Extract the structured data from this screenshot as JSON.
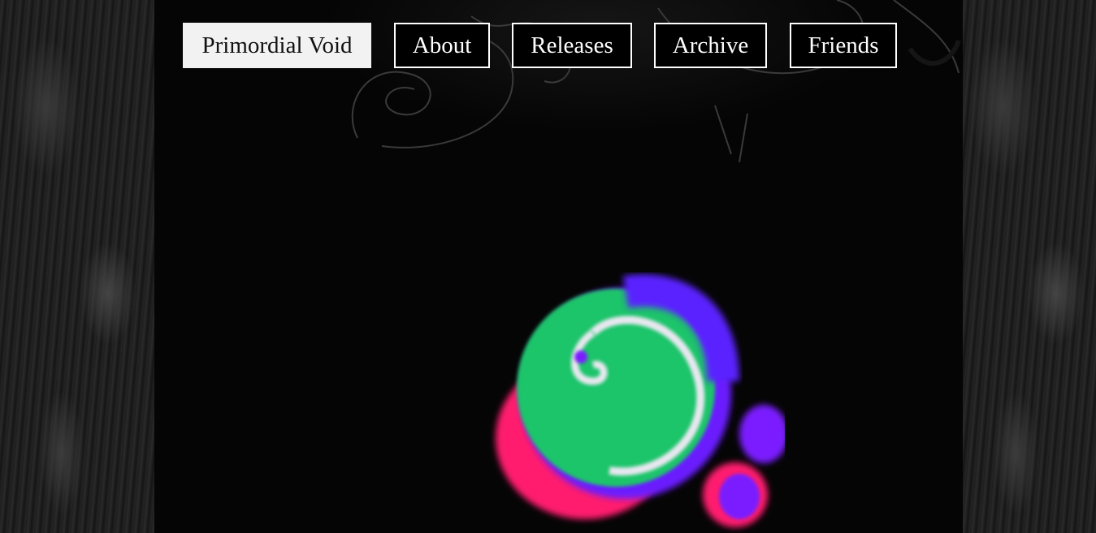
{
  "nav": {
    "items": [
      {
        "label": "Primordial Void",
        "active": true
      },
      {
        "label": "About",
        "active": false
      },
      {
        "label": "Releases",
        "active": false
      },
      {
        "label": "Archive",
        "active": false
      },
      {
        "label": "Friends",
        "active": false
      }
    ]
  },
  "colors": {
    "background": "#050505",
    "nav_border": "#ffffff",
    "nav_active_bg": "#f2f2f2",
    "orb_green": "#1fc46a",
    "orb_purple": "#7a1cff",
    "orb_magenta": "#ff1a6e"
  }
}
